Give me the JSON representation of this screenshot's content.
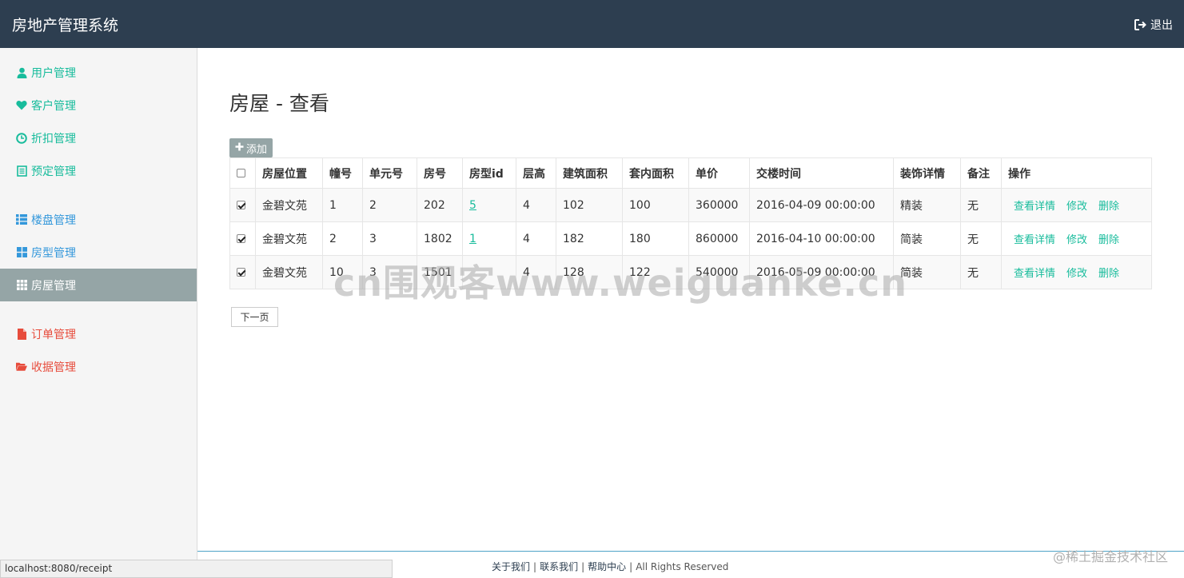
{
  "app": {
    "title": "房地产管理系统",
    "logout_label": "退出"
  },
  "sidebar": {
    "items": [
      {
        "label": "用户管理",
        "icon": "user-icon"
      },
      {
        "label": "客户管理",
        "icon": "heart-icon"
      },
      {
        "label": "折扣管理",
        "icon": "clock-icon"
      },
      {
        "label": "预定管理",
        "icon": "list-alt-icon"
      },
      {
        "label": "楼盘管理",
        "icon": "th-list-icon"
      },
      {
        "label": "房型管理",
        "icon": "th-large-icon"
      },
      {
        "label": "房屋管理",
        "icon": "th-icon",
        "active": true
      },
      {
        "label": "订单管理",
        "icon": "file-icon"
      },
      {
        "label": "收据管理",
        "icon": "folder-open-icon"
      }
    ]
  },
  "main": {
    "title": "房屋 - 查看",
    "add_label": "添加",
    "next_label": "下一页"
  },
  "table": {
    "headers": [
      "房屋位置",
      "幢号",
      "单元号",
      "房号",
      "房型id",
      "层高",
      "建筑面积",
      "套内面积",
      "单价",
      "交楼时间",
      "装饰详情",
      "备注",
      "操作"
    ],
    "rows": [
      {
        "checked": true,
        "cells": [
          "金碧文苑",
          "1",
          "2",
          "202",
          "5",
          "4",
          "102",
          "100",
          "360000",
          "2016-04-09 00:00:00",
          "精装",
          "无"
        ]
      },
      {
        "checked": true,
        "cells": [
          "金碧文苑",
          "2",
          "3",
          "1802",
          "1",
          "4",
          "182",
          "180",
          "860000",
          "2016-04-10 00:00:00",
          "简装",
          "无"
        ]
      },
      {
        "checked": true,
        "cells": [
          "金碧文苑",
          "10",
          "3",
          "1501",
          "",
          "4",
          "128",
          "122",
          "540000",
          "2016-05-09 00:00:00",
          "简装",
          "无"
        ]
      }
    ],
    "actions": {
      "view": "查看详情",
      "edit": "修改",
      "delete": "删除"
    }
  },
  "watermark": "cn围观客www.weiguanke.cn",
  "footer": {
    "about": "关于我们",
    "contact": "联系我们",
    "help": "帮助中心",
    "rights": "All Rights Reserved"
  },
  "statusbar": {
    "url": "localhost:8080/receipt"
  },
  "corner_watermark": "@稀土掘金技术社区",
  "colors": {
    "navbar": "#2d3e50",
    "teal": "#18bc9c",
    "blue": "#3498db",
    "red": "#e74c3c",
    "active": "#95a5a6"
  }
}
